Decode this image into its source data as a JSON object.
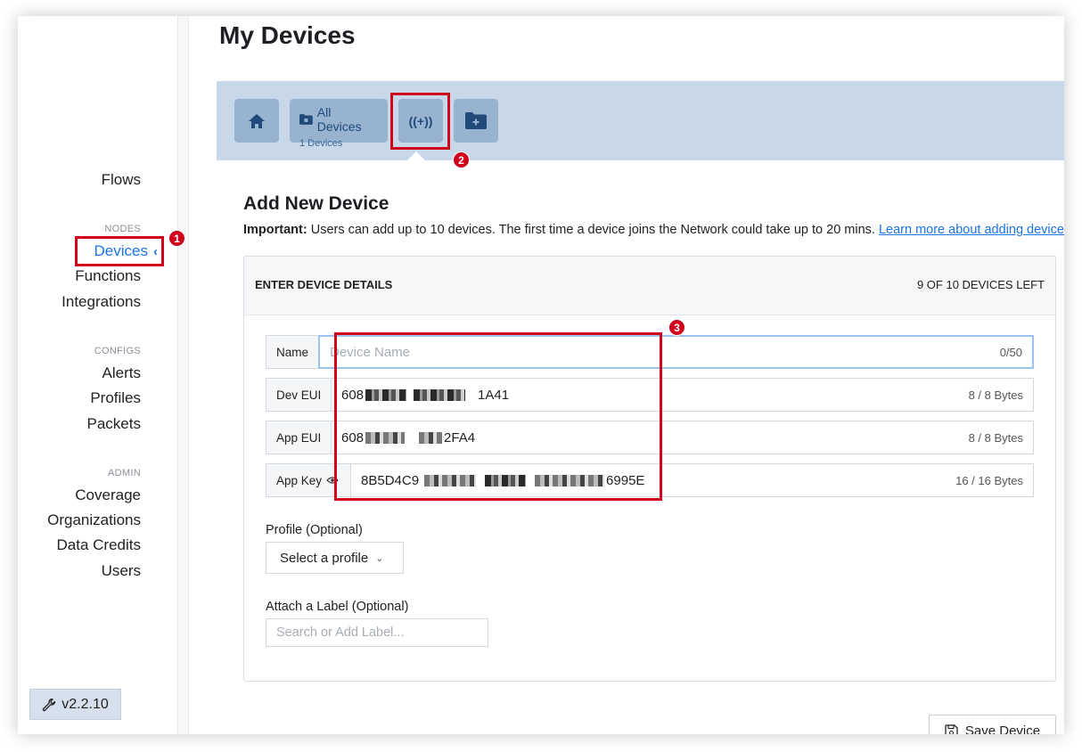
{
  "page": {
    "title": "My Devices"
  },
  "sidebar": {
    "flows": "Flows",
    "nodes_label": "NODES",
    "devices": "Devices",
    "functions": "Functions",
    "integrations": "Integrations",
    "configs_label": "CONFIGS",
    "alerts": "Alerts",
    "profiles": "Profiles",
    "packets": "Packets",
    "admin_label": "ADMIN",
    "coverage": "Coverage",
    "organizations": "Organizations",
    "data_credits": "Data Credits",
    "users": "Users",
    "version": "v2.2.10"
  },
  "toolbar": {
    "all_devices_label": "All Devices",
    "all_devices_count": "1 Devices",
    "radio_glyph": "((+))"
  },
  "form": {
    "heading": "Add New Device",
    "important_bold": "Important:",
    "important_text": " Users can add up to 10 devices. The first time a device joins the Network could take up to 20 mins. ",
    "learn_more": "Learn more about adding devices",
    "card_title": "ENTER DEVICE DETAILS",
    "devices_left": "9 OF 10 DEVICES LEFT",
    "name_label": "Name",
    "name_placeholder": "Device Name",
    "name_count": "0/50",
    "dev_eui_label": "Dev EUI",
    "dev_eui_prefix": "608",
    "dev_eui_suffix": "1A41",
    "dev_eui_count": "8 / 8 Bytes",
    "app_eui_label": "App EUI",
    "app_eui_prefix": "608",
    "app_eui_suffix": "2FA4",
    "app_eui_count": "8 / 8 Bytes",
    "app_key_label": "App Key",
    "app_key_prefix": "8B5D4C9",
    "app_key_suffix": "6995E",
    "app_key_count": "16 / 16 Bytes",
    "profile_label": "Profile (Optional)",
    "profile_select": "Select a profile",
    "attach_label": "Attach a Label (Optional)",
    "label_placeholder": "Search or Add Label...",
    "save_button": "Save Device"
  },
  "annotations": {
    "one": "1",
    "two": "2",
    "three": "3"
  },
  "colors": {
    "accent": "#1a73e8",
    "annotation": "#d0021b",
    "toolbar_band": "#c9d8e8",
    "toolbar_button": "#98b3cf"
  }
}
